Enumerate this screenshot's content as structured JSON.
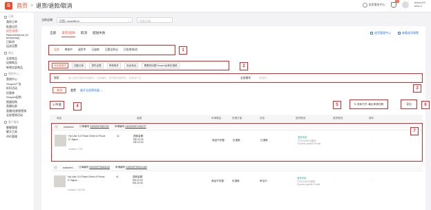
{
  "topbar": {
    "home": "首页",
    "separator": ">",
    "current": "退货/退款/取消",
    "service_label": "卖家服务中心",
    "notif_count": "19",
    "user_line1": "seema123",
    "user_line2": "seller ▾"
  },
  "sidebar": {
    "groups": [
      {
        "title": "订单",
        "items": [
          "我的订单",
          "批量出货",
          "退货/退款",
          "Return/Refund (VI temporary)",
          "已取消",
          "运送设置"
        ]
      },
      {
        "title": "商品",
        "items": [
          "全部商品",
          "店铺商品",
          "新增全部商品"
        ]
      },
      {
        "title": "营销中心",
        "items": [
          "营销中心",
          "Shopee广告",
          "折扣活动",
          "优惠券",
          "Shopee促销",
          "限量抢购",
          "直播社群",
          "直播/短视频营销",
          "全部营销活动"
        ]
      },
      {
        "title": "客户服务",
        "items": [
          "聊聊管理",
          "聊天工具",
          "评价管理"
        ]
      }
    ]
  },
  "header": {
    "shop_label": "当前店铺",
    "shop_value": "巴西 / cirac55.br",
    "search_placeholder": "搜索店铺"
  },
  "tabs": [
    "全部",
    "退货/退款",
    "取消",
    "配送失败"
  ],
  "card_links": [
    "退货管理中心",
    "查看退货政策"
  ],
  "status_filters": [
    "全部",
    "审核中",
    "退货中",
    "已退款",
    "已提出争议",
    "已拒绝/取消"
  ],
  "action_filters": [
    "待处理退货",
    "回复买家",
    "提供证据",
    "审核取件",
    "验证商品",
    "需要您回复Shopee运单的退款"
  ],
  "filter": {
    "search_label": "搜索",
    "search_placeholder": "输入退货/退款申请编号、订单编号、退货物流追踪号、买家用户名",
    "type_label": "全部操作",
    "type_placeholder": "请选择"
  },
  "buttons": {
    "search": "查询",
    "reset": "重置",
    "more": "展开全部筛选器 ⌄",
    "sort": "⇅ 排序方式: 最近申请日期",
    "export": "导出"
  },
  "count_text": "3 申请",
  "table_headers": [
    "商品",
    "金额",
    "申请理由",
    "处理方案",
    "状态",
    "退货物流",
    "退货物流",
    "操作"
  ],
  "orders": [
    {
      "buyer": "ezbeebr1",
      "order_label": "订单编号",
      "order_no": "240920FS8D72E",
      "request_label": "申请编号",
      "request_no": "240920DFVG83TF",
      "product": "Hp Usb 3.0 Flash Drive A Prova D' Água...",
      "variation": "Variation: 2TB",
      "qty": "x1",
      "amount_line1": "退款金额",
      "amount_line2": "R$ 22.00",
      "amount_line3": "R$ 22.00",
      "reason": "商品不完整",
      "solution": "仅退款",
      "status": "已退款",
      "ship_line1": "退货完成",
      "ship_line2": "于2024/09/20退货",
      "ship_line3": "Express padrão Postal",
      "dash1": "-",
      "dash2": "-"
    },
    {
      "buyer": "ezbeebr1",
      "order_label": "订单编号",
      "order_no": "240920FS5AB11B",
      "request_label": "申请编号",
      "request_no": "240920F5WGL065",
      "product": "Hp Usb 3.0 Flash Drive A Prova D' Água...",
      "variation": "Variation: 512GB",
      "qty": "x1",
      "amount_line1": "退款金额",
      "amount_line2": "R$ 22.00",
      "amount_line3": "R$ 22.00",
      "reason": "商品不完整",
      "solution": "仅退款",
      "status": "争议中",
      "ship_line1": "退货完成",
      "ship_line2": "于2024/09/20退货",
      "ship_line3": "Express padrão Postal",
      "dash1": "-",
      "dash2": "-"
    }
  ],
  "labels": [
    "1",
    "2",
    "3",
    "4",
    "5",
    "6",
    "7"
  ]
}
